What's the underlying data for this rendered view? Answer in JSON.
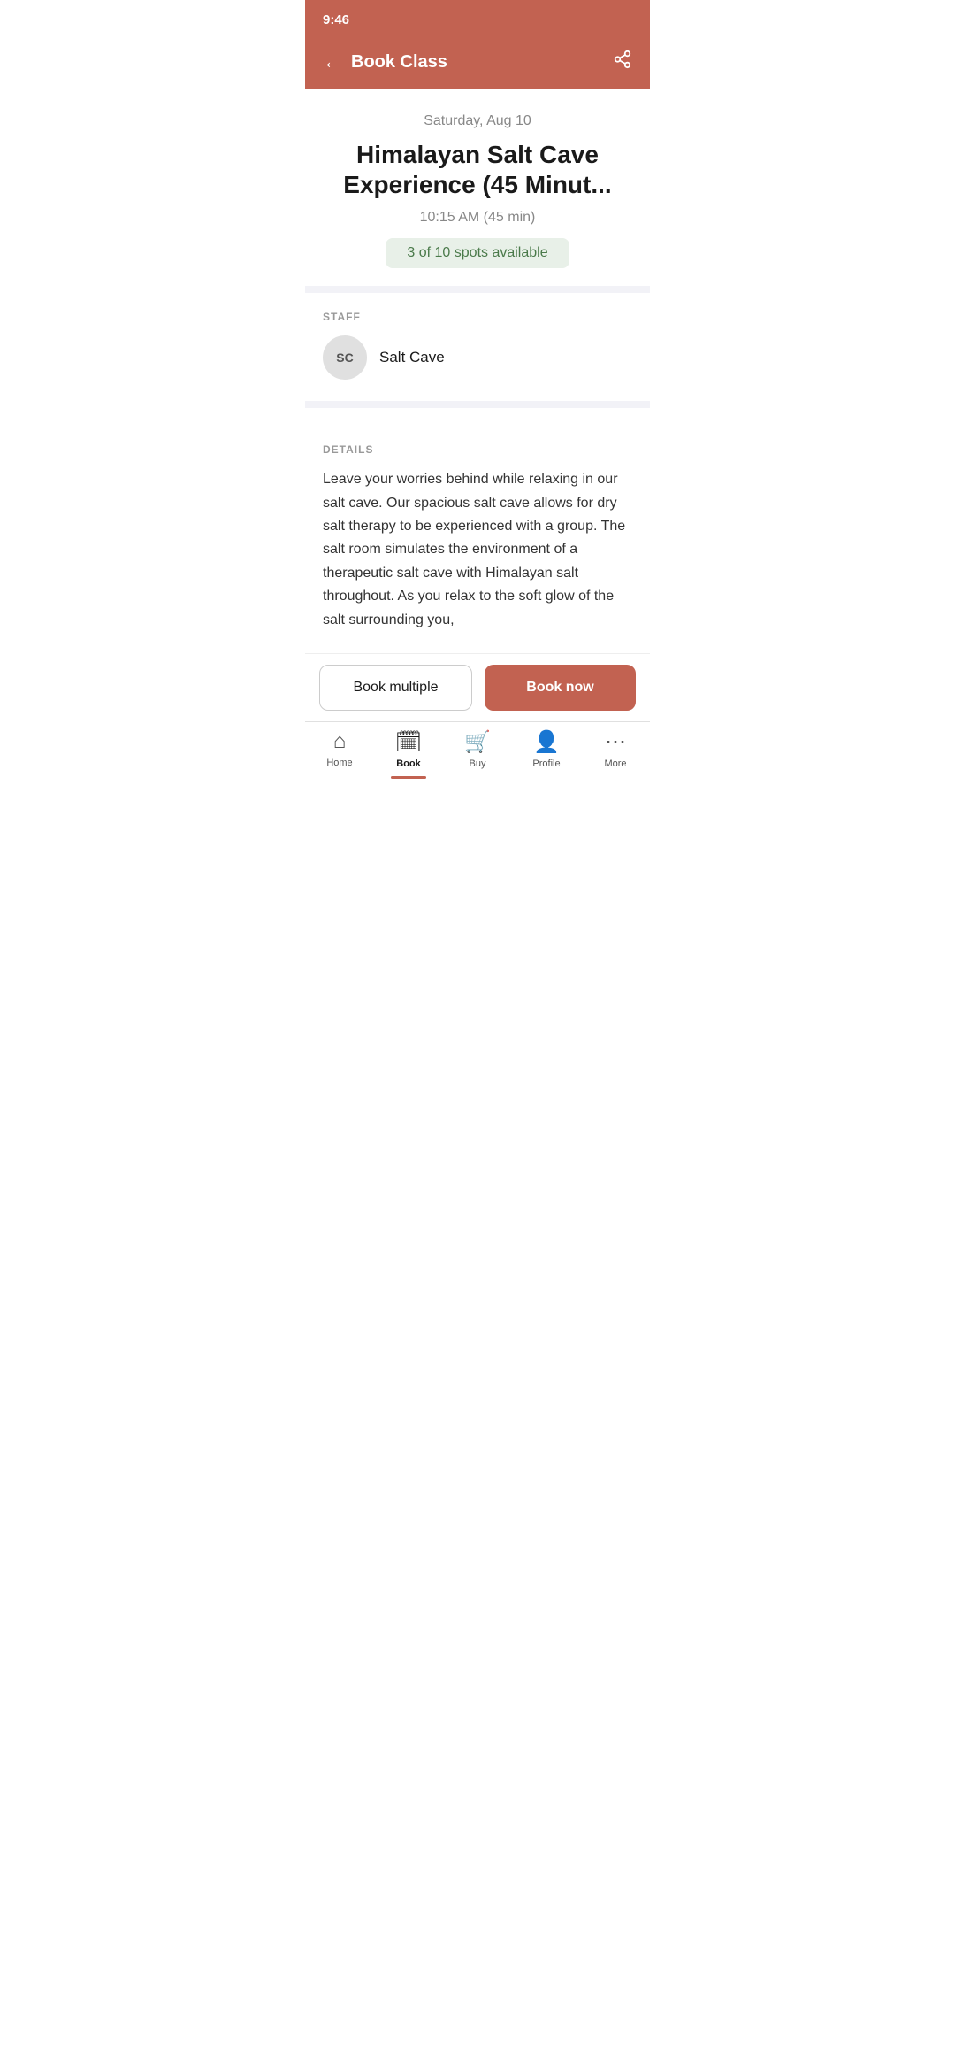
{
  "status": {
    "time": "9:46"
  },
  "header": {
    "title": "Book Class",
    "back_label": "←",
    "share_label": "share"
  },
  "hero": {
    "date": "Saturday, Aug 10",
    "class_title": "Himalayan Salt Cave Experience (45 Minut...",
    "time": "10:15 AM (45 min)",
    "spots": "3 of 10 spots available"
  },
  "staff": {
    "section_label": "STAFF",
    "avatar_initials": "SC",
    "name": "Salt Cave"
  },
  "details": {
    "section_label": "DETAILS",
    "description": "Leave your worries behind while relaxing in our salt cave. Our spacious salt cave allows for dry salt therapy to be experienced with a group. The salt room simulates the environment of a therapeutic salt cave with Himalayan salt throughout. As you relax to the soft glow of the salt surrounding you,"
  },
  "buttons": {
    "book_multiple": "Book multiple",
    "book_now": "Book now"
  },
  "nav": {
    "items": [
      {
        "label": "Home",
        "icon": "🏠"
      },
      {
        "label": "Book",
        "icon": "📅"
      },
      {
        "label": "Buy",
        "icon": "🛍"
      },
      {
        "label": "Profile",
        "icon": "👤"
      },
      {
        "label": "More",
        "icon": "···"
      }
    ]
  },
  "colors": {
    "accent": "#c26251",
    "spots_bg": "#e8f0e8",
    "spots_text": "#4a7a4a"
  }
}
